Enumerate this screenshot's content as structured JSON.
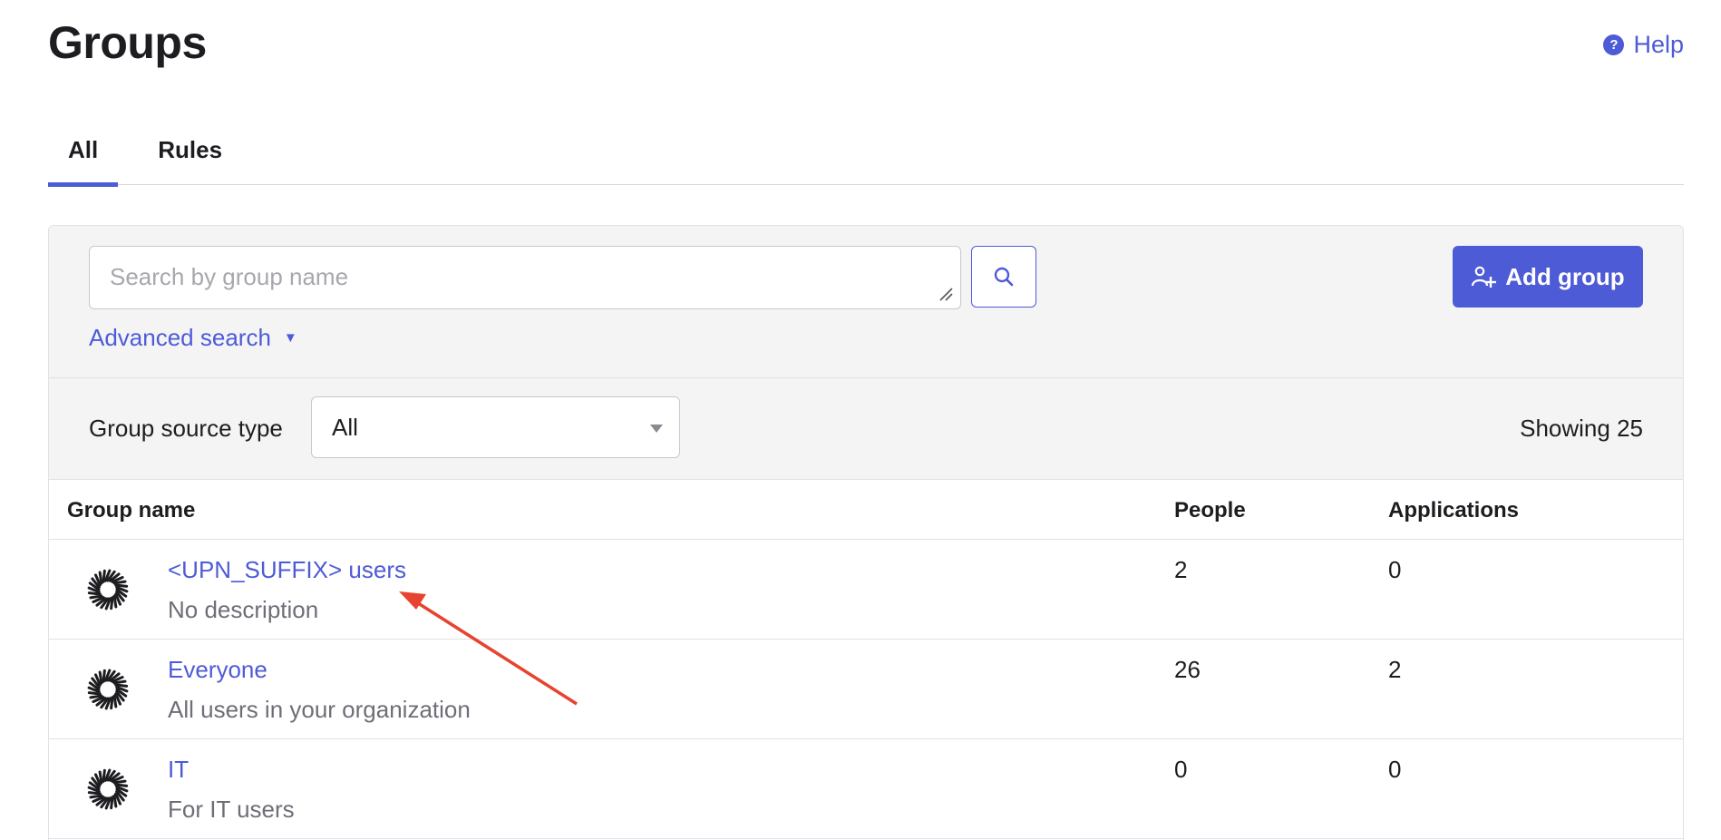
{
  "header": {
    "title": "Groups",
    "help_label": "Help",
    "help_icon_glyph": "?"
  },
  "tabs": [
    {
      "label": "All",
      "active": true
    },
    {
      "label": "Rules",
      "active": false
    }
  ],
  "toolbar": {
    "search_placeholder": "Search by group name",
    "search_value": "",
    "add_group_label": "Add group",
    "advanced_search_label": "Advanced search",
    "advanced_search_caret": "▼"
  },
  "filter": {
    "label": "Group source type",
    "selected": "All",
    "showing": "Showing 25"
  },
  "table": {
    "columns": [
      "Group name",
      "People",
      "Applications"
    ],
    "rows": [
      {
        "name": "<UPN_SUFFIX> users",
        "description": "No description",
        "people": "2",
        "applications": "0"
      },
      {
        "name": "Everyone",
        "description": "All users in your organization",
        "people": "26",
        "applications": "2"
      },
      {
        "name": "IT",
        "description": "For IT users",
        "people": "0",
        "applications": "0"
      }
    ]
  },
  "colors": {
    "accent": "#4e5bd6",
    "annotation_arrow": "#e8432e"
  },
  "icons": {
    "help": "help-circle-icon",
    "search": "search-icon",
    "add_group": "add-group-icon",
    "group_row": "group-burst-icon"
  }
}
